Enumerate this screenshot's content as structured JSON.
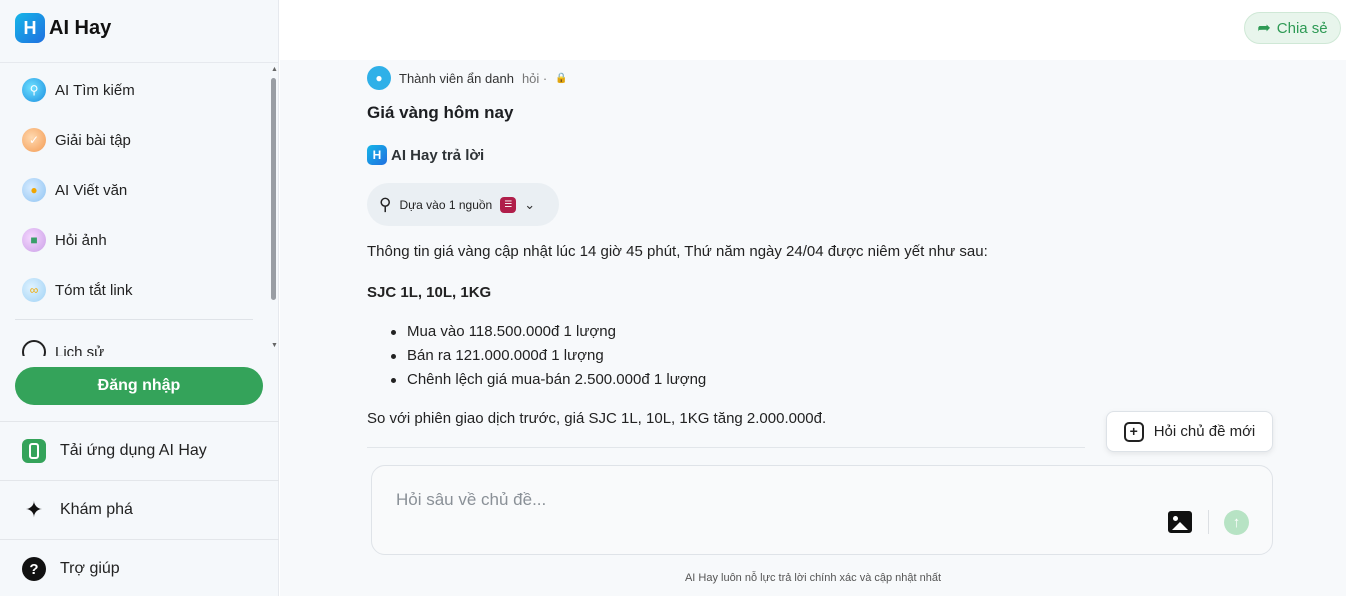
{
  "brand": {
    "name": "AI Hay",
    "logo_letter": "H"
  },
  "sidebar": {
    "items": [
      {
        "label": "AI Tìm kiếm",
        "icon": "ai-search-icon"
      },
      {
        "label": "Giải bài tập",
        "icon": "homework-icon"
      },
      {
        "label": "AI Viết văn",
        "icon": "writing-icon"
      },
      {
        "label": "Hỏi ảnh",
        "icon": "image-question-icon"
      },
      {
        "label": "Tóm tắt link",
        "icon": "link-summary-icon"
      }
    ],
    "history_label": "Lịch sử",
    "login_label": "Đăng nhập",
    "download_app_label": "Tải ứng dụng AI Hay",
    "explore_label": "Khám phá",
    "help_label": "Trợ giúp"
  },
  "header": {
    "share_label": "Chia sẻ"
  },
  "thread": {
    "asker_name": "Thành viên ẩn danh",
    "asker_verb": "hỏi ·",
    "question": "Giá vàng hôm nay",
    "answerer": "AI Hay trả lời",
    "source_label": "Dựa vào 1 nguồn",
    "intro": "Thông tin giá vàng cập nhật lúc 14 giờ 45 phút, Thứ năm ngày 24/04 được niêm yết như sau:",
    "heading": "SJC 1L, 10L, 1KG",
    "bullets": [
      "Mua vào 118.500.000đ 1 lượng",
      "Bán ra 121.000.000đ 1 lượng",
      "Chênh lệch giá mua-bán 2.500.000đ 1 lượng"
    ],
    "comparison": "So với phiên giao dịch trước, giá SJC 1L, 10L, 1KG tăng 2.000.000đ."
  },
  "new_topic_label": "Hỏi chủ đề mới",
  "composer": {
    "placeholder": "Hỏi sâu về chủ đề..."
  },
  "disclaimer": "AI Hay luôn nỗ lực trả lời chính xác và cập nhật nhất",
  "colors": {
    "brand_green": "#34a35a",
    "brand_blue": "#1f6fe0",
    "send_disabled": "#b7e3c4"
  }
}
